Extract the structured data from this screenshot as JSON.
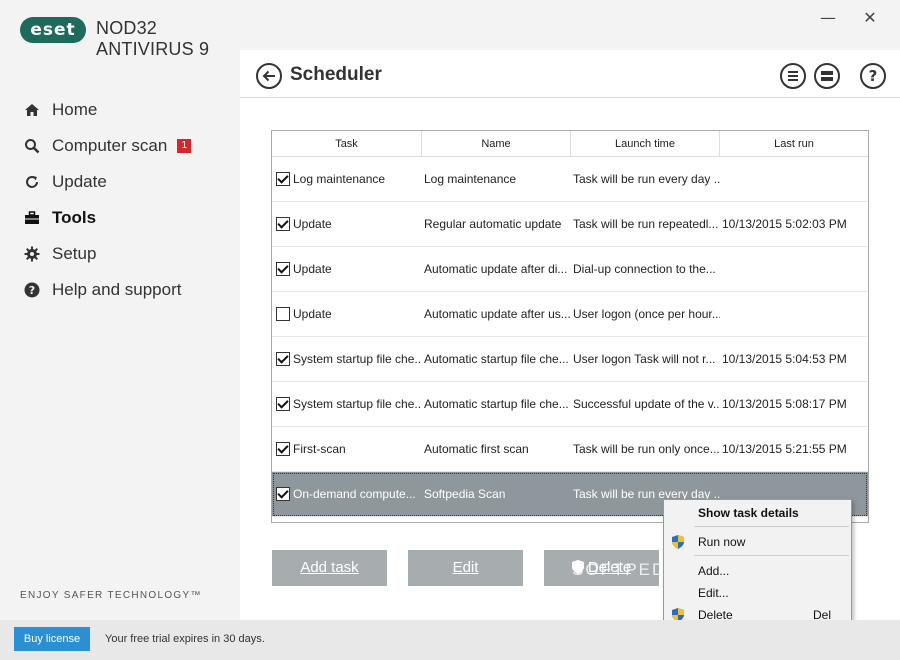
{
  "app": {
    "logo": "eset",
    "product": "NOD32 ANTIVIRUS 9",
    "tagline": "ENJOY SAFER TECHNOLOGY™"
  },
  "window": {
    "minimize": "—",
    "close": "✕"
  },
  "sidebar": {
    "items": [
      {
        "label": "Home",
        "icon": "home-icon"
      },
      {
        "label": "Computer scan",
        "icon": "magnifier-icon",
        "badge": "1"
      },
      {
        "label": "Update",
        "icon": "refresh-icon"
      },
      {
        "label": "Tools",
        "icon": "briefcase-icon",
        "active": true
      },
      {
        "label": "Setup",
        "icon": "gear-icon"
      },
      {
        "label": "Help and support",
        "icon": "help-icon"
      }
    ]
  },
  "page": {
    "title": "Scheduler",
    "help": "?"
  },
  "table": {
    "columns": [
      "Task",
      "Name",
      "Launch time",
      "Last run"
    ],
    "rows": [
      {
        "checked": true,
        "task": "Log maintenance",
        "name": "Log maintenance",
        "launch": "Task will be run every day ...",
        "last": ""
      },
      {
        "checked": true,
        "task": "Update",
        "name": "Regular automatic update",
        "launch": "Task will be run repeatedl...",
        "last": "10/13/2015 5:02:03 PM"
      },
      {
        "checked": true,
        "task": "Update",
        "name": "Automatic update after di...",
        "launch": "Dial-up connection to the...",
        "last": ""
      },
      {
        "checked": false,
        "task": "Update",
        "name": "Automatic update after us...",
        "launch": "User logon (once per hour...",
        "last": ""
      },
      {
        "checked": true,
        "task": "System startup file che...",
        "name": "Automatic startup file che...",
        "launch": "User logon Task will not r...",
        "last": "10/13/2015 5:04:53 PM"
      },
      {
        "checked": true,
        "task": "System startup file che...",
        "name": "Automatic startup file che...",
        "launch": "Successful update of the v...",
        "last": "10/13/2015 5:08:17 PM"
      },
      {
        "checked": true,
        "task": "First-scan",
        "name": "Automatic first scan",
        "launch": "Task will be run only once...",
        "last": "10/13/2015 5:21:55 PM"
      },
      {
        "checked": true,
        "task": "On-demand compute...",
        "name": "Softpedia Scan",
        "launch": "Task will be run every day ...",
        "last": "",
        "selected": true
      }
    ]
  },
  "buttons": {
    "add_task": "Add task",
    "edit": "Edit",
    "delete": "Delete"
  },
  "watermark": "SOFTPEDIA",
  "context_menu": {
    "show_details": "Show task details",
    "run_now": "Run now",
    "add": "Add...",
    "edit": "Edit...",
    "delete": "Delete",
    "delete_key": "Del"
  },
  "footer": {
    "buy_license": "Buy license",
    "trial_text": "Your free trial expires in 30 days."
  },
  "colors": {
    "accent": "#2b8fd4",
    "logo": "#1e6b5e",
    "badge": "#d9262b",
    "selected_row": "#8e979b",
    "button": "#a7acae"
  }
}
